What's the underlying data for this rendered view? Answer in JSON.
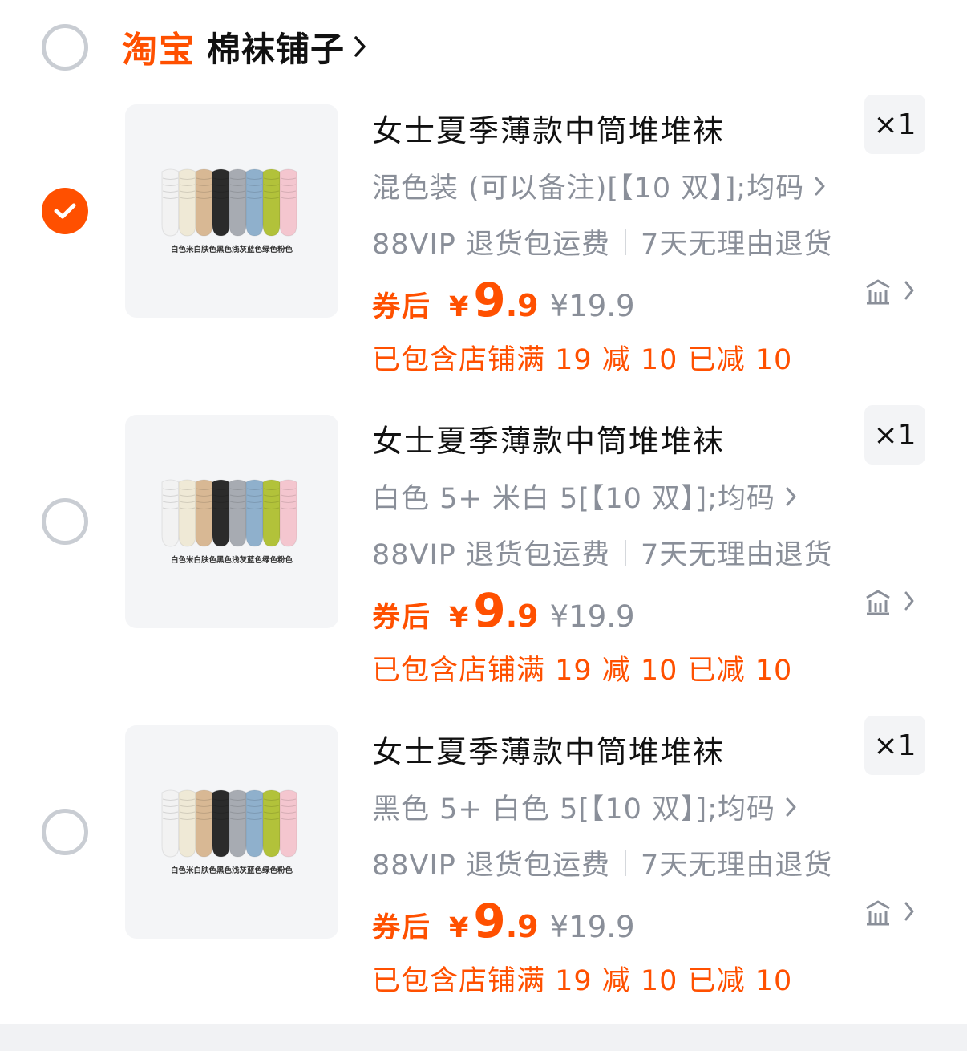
{
  "shop": {
    "brand": "淘宝",
    "name": "棉袜铺子",
    "selected": false,
    "chevron_icon": "chevron-right-icon"
  },
  "items": [
    {
      "selected": true,
      "title": "女士夏季薄款中筒堆堆袜",
      "spec": "混色装 (可以备注)[【10 双】];均码",
      "service_1": "88VIP 退货包运费",
      "service_2": "7天无理由退货",
      "coupon_label": "券后",
      "currency": "¥",
      "price_int": "9",
      "price_dec": ".9",
      "orig_price": "¥19.9",
      "promo": "已包含店铺满 19 减 10 已减 10",
      "qty": "×1",
      "image_caption": "白色米白肤色黑色浅灰蓝色绿色粉色"
    },
    {
      "selected": false,
      "title": "女士夏季薄款中筒堆堆袜",
      "spec": "白色 5+ 米白 5[【10 双】];均码",
      "service_1": "88VIP 退货包运费",
      "service_2": "7天无理由退货",
      "coupon_label": "券后",
      "currency": "¥",
      "price_int": "9",
      "price_dec": ".9",
      "orig_price": "¥19.9",
      "promo": "已包含店铺满 19 减 10 已减 10",
      "qty": "×1",
      "image_caption": "白色米白肤色黑色浅灰蓝色绿色粉色"
    },
    {
      "selected": false,
      "title": "女士夏季薄款中筒堆堆袜",
      "spec": "黑色 5+ 白色 5[【10 双】];均码",
      "service_1": "88VIP 退货包运费",
      "service_2": "7天无理由退货",
      "coupon_label": "券后",
      "currency": "¥",
      "price_int": "9",
      "price_dec": ".9",
      "orig_price": "¥19.9",
      "promo": "已包含店铺满 19 减 10 已减 10",
      "qty": "×1",
      "image_caption": "白色米白肤色黑色浅灰蓝色绿色粉色"
    }
  ],
  "colors": {
    "accent": "#ff5000",
    "muted_text": "#8a8f99",
    "radio_border": "#c9cdd3",
    "qty_bg": "#f3f4f6"
  },
  "sock_colors": [
    "#f2f2f2",
    "#efe9d6",
    "#d8b894",
    "#2b2b2b",
    "#a7abb2",
    "#8fb0cc",
    "#b2c23a",
    "#f4c6cf"
  ]
}
